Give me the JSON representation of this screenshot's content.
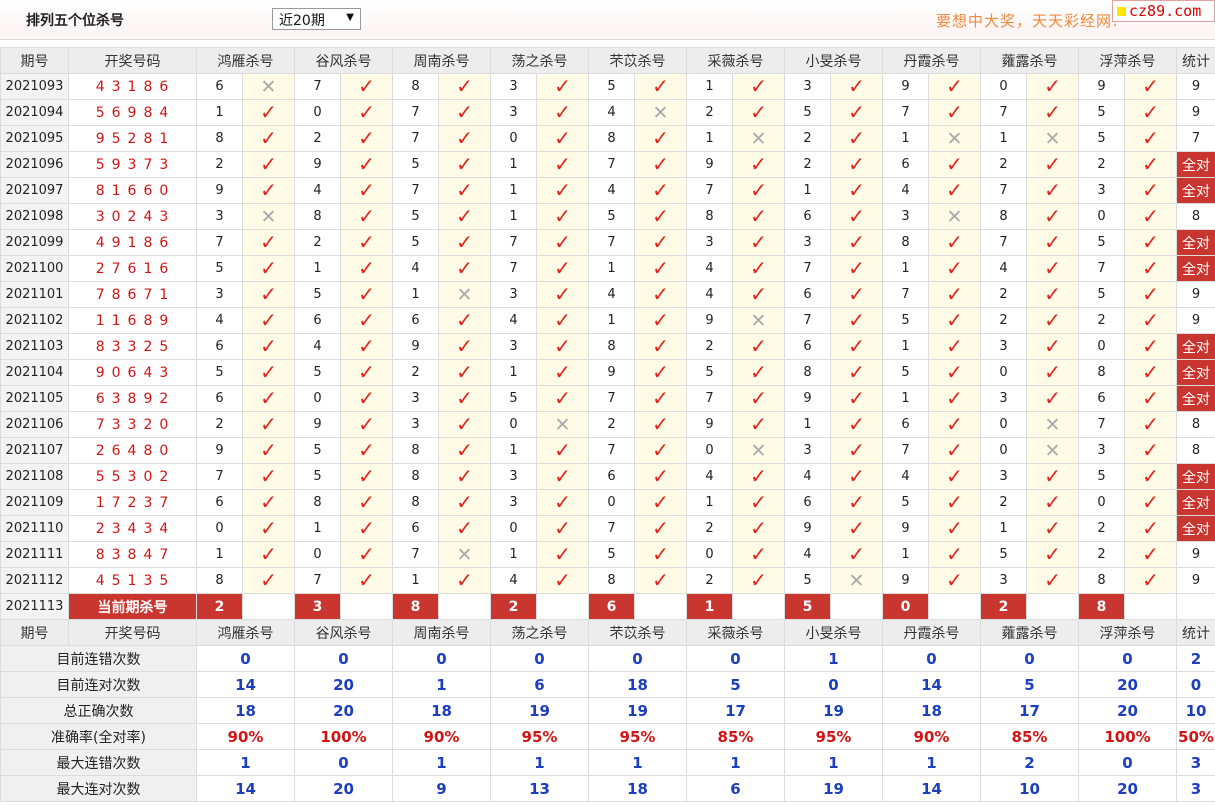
{
  "header": {
    "title": "排列五个位杀号",
    "period_select": "近20期",
    "promo": "要想中大奖，天天彩经网!",
    "logo_text": "cz89.com"
  },
  "columns": [
    "期号",
    "开奖号码",
    "鸿雁杀号",
    "谷风杀号",
    "周南杀号",
    "荡之杀号",
    "芣苡杀号",
    "采薇杀号",
    "小旻杀号",
    "丹霞杀号",
    "蕹露杀号",
    "浮萍杀号",
    "统计"
  ],
  "rows": [
    {
      "issue": "2021093",
      "draw": "43186",
      "kills": [
        6,
        7,
        8,
        3,
        5,
        1,
        3,
        9,
        0,
        9
      ],
      "hits": [
        0,
        1,
        1,
        1,
        1,
        1,
        1,
        1,
        1,
        1
      ],
      "stat": "9"
    },
    {
      "issue": "2021094",
      "draw": "56984",
      "kills": [
        1,
        0,
        7,
        3,
        4,
        2,
        5,
        7,
        7,
        5
      ],
      "hits": [
        1,
        1,
        1,
        1,
        0,
        1,
        1,
        1,
        1,
        1
      ],
      "stat": "9"
    },
    {
      "issue": "2021095",
      "draw": "95281",
      "kills": [
        8,
        2,
        7,
        0,
        8,
        1,
        2,
        1,
        1,
        5
      ],
      "hits": [
        1,
        1,
        1,
        1,
        1,
        0,
        1,
        0,
        0,
        1
      ],
      "stat": "7"
    },
    {
      "issue": "2021096",
      "draw": "59373",
      "kills": [
        2,
        9,
        5,
        1,
        7,
        9,
        2,
        6,
        2,
        2
      ],
      "hits": [
        1,
        1,
        1,
        1,
        1,
        1,
        1,
        1,
        1,
        1
      ],
      "stat": "全对"
    },
    {
      "issue": "2021097",
      "draw": "81660",
      "kills": [
        9,
        4,
        7,
        1,
        4,
        7,
        1,
        4,
        7,
        3
      ],
      "hits": [
        1,
        1,
        1,
        1,
        1,
        1,
        1,
        1,
        1,
        1
      ],
      "stat": "全对"
    },
    {
      "issue": "2021098",
      "draw": "30243",
      "kills": [
        3,
        8,
        5,
        1,
        5,
        8,
        6,
        3,
        8,
        0
      ],
      "hits": [
        0,
        1,
        1,
        1,
        1,
        1,
        1,
        0,
        1,
        1
      ],
      "stat": "8"
    },
    {
      "issue": "2021099",
      "draw": "49186",
      "kills": [
        7,
        2,
        5,
        7,
        7,
        3,
        3,
        8,
        7,
        5
      ],
      "hits": [
        1,
        1,
        1,
        1,
        1,
        1,
        1,
        1,
        1,
        1
      ],
      "stat": "全对"
    },
    {
      "issue": "2021100",
      "draw": "27616",
      "kills": [
        5,
        1,
        4,
        7,
        1,
        4,
        7,
        1,
        4,
        7
      ],
      "hits": [
        1,
        1,
        1,
        1,
        1,
        1,
        1,
        1,
        1,
        1
      ],
      "stat": "全对"
    },
    {
      "issue": "2021101",
      "draw": "78671",
      "kills": [
        3,
        5,
        1,
        3,
        4,
        4,
        6,
        7,
        2,
        5
      ],
      "hits": [
        1,
        1,
        0,
        1,
        1,
        1,
        1,
        1,
        1,
        1
      ],
      "stat": "9"
    },
    {
      "issue": "2021102",
      "draw": "11689",
      "kills": [
        4,
        6,
        6,
        4,
        1,
        9,
        7,
        5,
        2,
        2
      ],
      "hits": [
        1,
        1,
        1,
        1,
        1,
        0,
        1,
        1,
        1,
        1
      ],
      "stat": "9"
    },
    {
      "issue": "2021103",
      "draw": "83325",
      "kills": [
        6,
        4,
        9,
        3,
        8,
        2,
        6,
        1,
        3,
        0
      ],
      "hits": [
        1,
        1,
        1,
        1,
        1,
        1,
        1,
        1,
        1,
        1
      ],
      "stat": "全对"
    },
    {
      "issue": "2021104",
      "draw": "90643",
      "kills": [
        5,
        5,
        2,
        1,
        9,
        5,
        8,
        5,
        0,
        8
      ],
      "hits": [
        1,
        1,
        1,
        1,
        1,
        1,
        1,
        1,
        1,
        1
      ],
      "stat": "全对"
    },
    {
      "issue": "2021105",
      "draw": "63892",
      "kills": [
        6,
        0,
        3,
        5,
        7,
        7,
        9,
        1,
        3,
        6
      ],
      "hits": [
        1,
        1,
        1,
        1,
        1,
        1,
        1,
        1,
        1,
        1
      ],
      "stat": "全对"
    },
    {
      "issue": "2021106",
      "draw": "73320",
      "kills": [
        2,
        9,
        3,
        0,
        2,
        9,
        1,
        6,
        0,
        7
      ],
      "hits": [
        1,
        1,
        1,
        0,
        1,
        1,
        1,
        1,
        0,
        1
      ],
      "stat": "8"
    },
    {
      "issue": "2021107",
      "draw": "26480",
      "kills": [
        9,
        5,
        8,
        1,
        7,
        0,
        3,
        7,
        0,
        3
      ],
      "hits": [
        1,
        1,
        1,
        1,
        1,
        0,
        1,
        1,
        0,
        1
      ],
      "stat": "8"
    },
    {
      "issue": "2021108",
      "draw": "55302",
      "kills": [
        7,
        5,
        8,
        3,
        6,
        4,
        4,
        4,
        3,
        5
      ],
      "hits": [
        1,
        1,
        1,
        1,
        1,
        1,
        1,
        1,
        1,
        1
      ],
      "stat": "全对"
    },
    {
      "issue": "2021109",
      "draw": "17237",
      "kills": [
        6,
        8,
        8,
        3,
        0,
        1,
        6,
        5,
        2,
        0
      ],
      "hits": [
        1,
        1,
        1,
        1,
        1,
        1,
        1,
        1,
        1,
        1
      ],
      "stat": "全对"
    },
    {
      "issue": "2021110",
      "draw": "23434",
      "kills": [
        0,
        1,
        6,
        0,
        7,
        2,
        9,
        9,
        1,
        2
      ],
      "hits": [
        1,
        1,
        1,
        1,
        1,
        1,
        1,
        1,
        1,
        1
      ],
      "stat": "全对"
    },
    {
      "issue": "2021111",
      "draw": "83847",
      "kills": [
        1,
        0,
        7,
        1,
        5,
        0,
        4,
        1,
        5,
        2
      ],
      "hits": [
        1,
        1,
        0,
        1,
        1,
        1,
        1,
        1,
        1,
        1
      ],
      "stat": "9"
    },
    {
      "issue": "2021112",
      "draw": "45135",
      "kills": [
        8,
        7,
        1,
        4,
        8,
        2,
        5,
        9,
        3,
        8
      ],
      "hits": [
        1,
        1,
        1,
        1,
        1,
        1,
        0,
        1,
        1,
        1
      ],
      "stat": "9"
    }
  ],
  "current": {
    "issue": "2021113",
    "label": "当前期杀号",
    "kills": [
      2,
      3,
      8,
      2,
      6,
      1,
      5,
      0,
      2,
      8
    ]
  },
  "summary": [
    {
      "label": "目前连错次数",
      "values": [
        "0",
        "0",
        "0",
        "0",
        "0",
        "0",
        "1",
        "0",
        "0",
        "0"
      ],
      "stat": "2"
    },
    {
      "label": "目前连对次数",
      "values": [
        "14",
        "20",
        "1",
        "6",
        "18",
        "5",
        "0",
        "14",
        "5",
        "20"
      ],
      "stat": "0"
    },
    {
      "label": "总正确次数",
      "values": [
        "18",
        "20",
        "18",
        "19",
        "19",
        "17",
        "19",
        "18",
        "17",
        "20"
      ],
      "stat": "10"
    },
    {
      "label": "准确率(全对率)",
      "values": [
        "90%",
        "100%",
        "90%",
        "95%",
        "95%",
        "85%",
        "95%",
        "90%",
        "85%",
        "100%"
      ],
      "stat": "50%"
    },
    {
      "label": "最大连错次数",
      "values": [
        "1",
        "0",
        "1",
        "1",
        "1",
        "1",
        "1",
        "1",
        "2",
        "0"
      ],
      "stat": "3"
    },
    {
      "label": "最大连对次数",
      "values": [
        "14",
        "20",
        "9",
        "13",
        "18",
        "6",
        "19",
        "14",
        "10",
        "20"
      ],
      "stat": "3"
    }
  ]
}
